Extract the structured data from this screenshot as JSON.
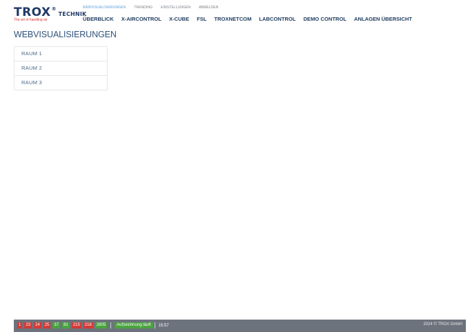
{
  "logo": {
    "name": "TROX",
    "reg": "®",
    "suffix": "TECHNIK",
    "tagline": "The art of handling air"
  },
  "subnav": {
    "items": [
      {
        "label": "WEBVISUALISIERUNGEN",
        "active": true
      },
      {
        "label": "TRENDING",
        "active": false
      },
      {
        "label": "EINSTELLUNGEN",
        "active": false
      },
      {
        "label": "ABMELDEN",
        "active": false
      }
    ]
  },
  "mainnav": {
    "items": [
      {
        "label": "ÜBERBLICK"
      },
      {
        "label": "X-AIRCONTROL"
      },
      {
        "label": "X-CUBE"
      },
      {
        "label": "FSL"
      },
      {
        "label": "TROXNETCOM"
      },
      {
        "label": "LABCONTROL"
      },
      {
        "label": "DEMO CONTROL"
      },
      {
        "label": "ANLAGEN ÜBERSICHT"
      }
    ]
  },
  "page": {
    "title": "WEBVISUALISIERUNGEN",
    "rooms": [
      {
        "label": "RAUM 1"
      },
      {
        "label": "RAUM 2"
      },
      {
        "label": "RAUM 3"
      }
    ]
  },
  "statusbar": {
    "chips": [
      {
        "label": "1",
        "color": "red"
      },
      {
        "label": "23",
        "color": "red"
      },
      {
        "label": "24",
        "color": "red"
      },
      {
        "label": "25",
        "color": "red"
      },
      {
        "label": "37",
        "color": "green"
      },
      {
        "label": "81",
        "color": "green"
      },
      {
        "label": "215",
        "color": "red"
      },
      {
        "label": "216",
        "color": "red"
      },
      {
        "label": "2805",
        "color": "green"
      }
    ],
    "recording": "Aufzeichnung läuft",
    "time": "15:57",
    "copyright": "2024 © TROX GmbH"
  },
  "colors": {
    "brand_blue": "#1f3a67",
    "accent_red": "#d23b37",
    "status_green": "#4aa33f",
    "statusbar_bg": "#6d737d",
    "active_link": "#5a9ed8"
  }
}
